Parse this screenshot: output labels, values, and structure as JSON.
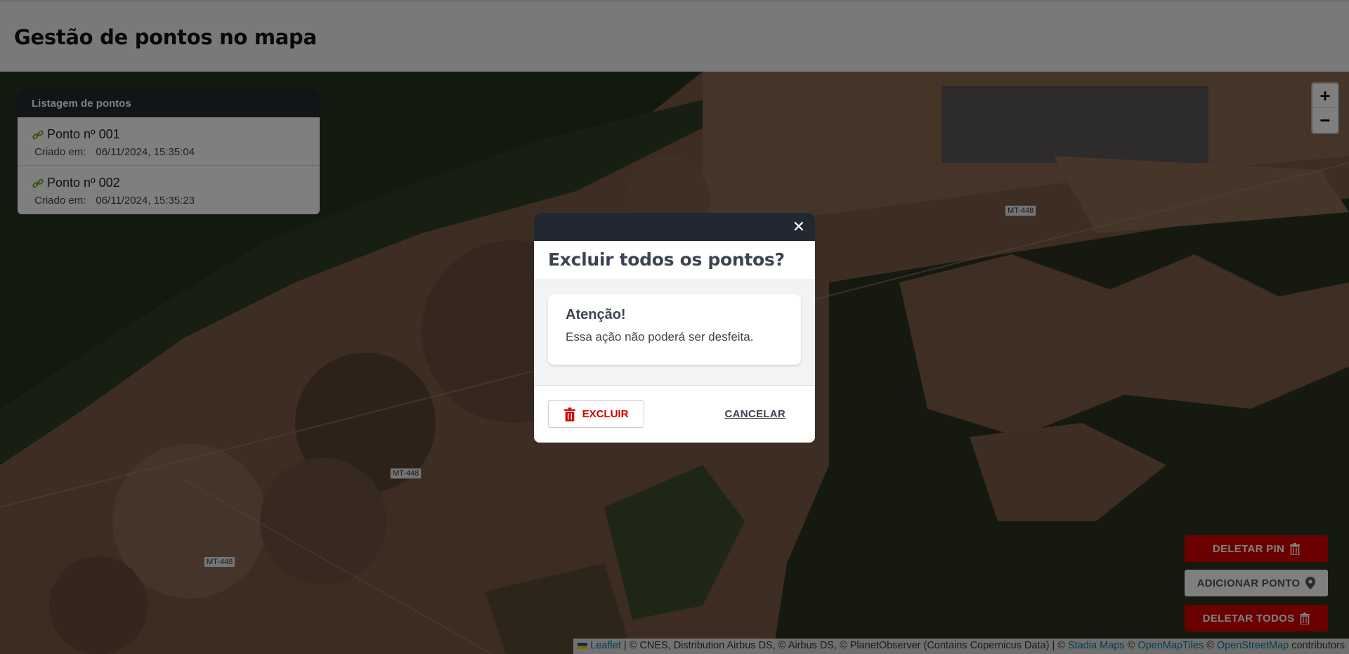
{
  "header": {
    "title": "Gestão de pontos no mapa"
  },
  "map": {
    "zoom_in": "+",
    "zoom_out": "−",
    "road_labels": [
      "MT-448",
      "MT-448",
      "MT-448"
    ],
    "attribution": {
      "leaflet": "Leaflet",
      "sep1": " | © CNES, Distribution Airbus DS, © Airbus DS, © PlanetObserver (Contains Copernicus Data) | © ",
      "stadia": "Stadia Maps",
      "copy1": " © ",
      "omt": "OpenMapTiles",
      "copy2": " © ",
      "osm": "OpenStreetMap",
      "contributors": " contributors"
    }
  },
  "points_panel": {
    "title": "Listagem de pontos",
    "items": [
      {
        "name": "Ponto nº 001",
        "created_label": "Criado em:",
        "created_at": "06/11/2024, 15:35:04"
      },
      {
        "name": "Ponto nº 002",
        "created_label": "Criado em:",
        "created_at": "06/11/2024, 15:35:23"
      }
    ]
  },
  "actions": {
    "delete_pin": "DELETAR PIN",
    "add_point": "ADICIONAR PONTO",
    "delete_all": "DELETAR TODOS"
  },
  "modal": {
    "close": "✕",
    "title": "Excluir todos os pontos?",
    "warning_title": "Atenção!",
    "warning_text": "Essa ação não poderá ser desfeita.",
    "confirm": "EXCLUIR",
    "cancel": "CANCELAR"
  },
  "colors": {
    "danger": "#d40000",
    "dark": "#222831",
    "link": "#0078a8"
  }
}
